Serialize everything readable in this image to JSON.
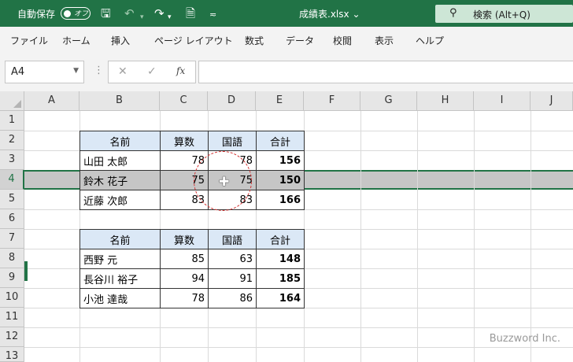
{
  "titlebar": {
    "autosave_label": "自動保存",
    "autosave_state": "オフ",
    "filename": "成績表.xlsx",
    "search_placeholder": "検索 (Alt+Q)"
  },
  "menu": [
    "ファイル",
    "ホーム",
    "挿入",
    "ページ レイアウト",
    "数式",
    "データ",
    "校閲",
    "表示",
    "ヘルプ"
  ],
  "formula_bar": {
    "name_box": "A4",
    "fx_label": "fx",
    "formula_value": ""
  },
  "columns": [
    "A",
    "B",
    "C",
    "D",
    "E",
    "F",
    "G",
    "H",
    "I",
    "J"
  ],
  "rows": [
    "1",
    "2",
    "3",
    "4",
    "5",
    "6",
    "7",
    "8",
    "9",
    "10",
    "11",
    "12",
    "13"
  ],
  "selected_row": "4",
  "table1": {
    "headers": [
      "名前",
      "算数",
      "国語",
      "合計"
    ],
    "rows": [
      {
        "name": "山田 太郎",
        "math": "78",
        "japanese": "78",
        "total": "156"
      },
      {
        "name": "鈴木 花子",
        "math": "75",
        "japanese": "75",
        "total": "150"
      },
      {
        "name": "近藤 次郎",
        "math": "83",
        "japanese": "83",
        "total": "166"
      }
    ]
  },
  "table2": {
    "headers": [
      "名前",
      "算数",
      "国語",
      "合計"
    ],
    "rows": [
      {
        "name": "西野 元",
        "math": "85",
        "japanese": "63",
        "total": "148"
      },
      {
        "name": "長谷川 裕子",
        "math": "94",
        "japanese": "91",
        "total": "185"
      },
      {
        "name": "小池 達哉",
        "math": "78",
        "japanese": "86",
        "total": "164"
      }
    ]
  },
  "watermark": "Buzzword Inc.",
  "colors": {
    "accent": "#217346",
    "header_fill": "#dbe8f6",
    "selection": "#c6c6c6",
    "circle": "#d32f2f"
  }
}
